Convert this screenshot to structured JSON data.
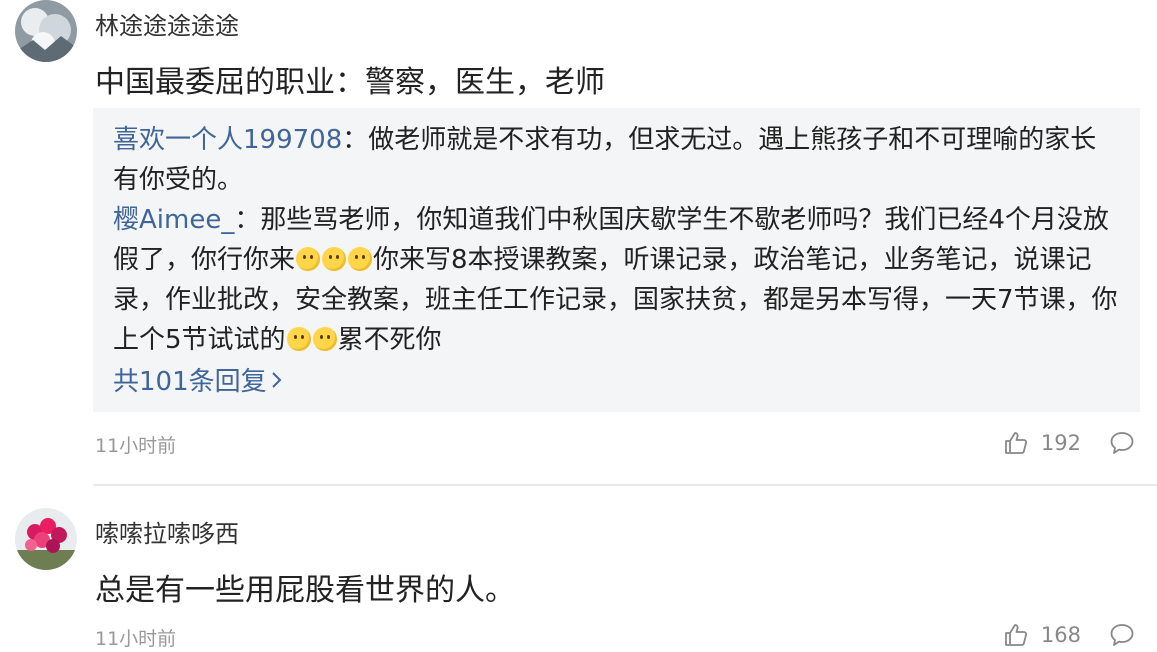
{
  "comments": [
    {
      "username": "林途途途途途",
      "content": "中国最委屈的职业：警察，医生，老师",
      "replies": [
        {
          "user": "喜欢一个人199708",
          "sep": "：",
          "text": "做老师就是不求有功，但求无过。遇上熊孩子和不可理喻的家长有你受的。"
        },
        {
          "user": "樱Aimee_",
          "sep": "：",
          "text_parts": [
            "那些骂老师，你知道我们中秋国庆歇学生不歇老师吗？我们已经4个月没放假了，你行你来",
            "你来写8本授课教案，听课记录，政治笔记，业务笔记，说课记录，作业批改，安全教案，班主任工作记录，国家扶贫，都是另本写得，一天7节课，你上个5节试试的",
            "累不死你"
          ],
          "emoji_groups": [
            3,
            2
          ],
          "emoji_icon": "smile-emoji-icon"
        }
      ],
      "more_replies": "共101条回复",
      "time": "11小时前",
      "likes": "192"
    },
    {
      "username": "嗦嗦拉嗦哆西",
      "content": "总是有一些用屁股看世界的人。",
      "time": "11小时前",
      "likes": "168"
    }
  ],
  "icons": {
    "like": "thumbs-up-icon",
    "reply": "comment-bubble-icon",
    "more": "chevron-right-icon"
  },
  "colors": {
    "link": "#406599",
    "reply_bg": "#f4f5f6",
    "meta": "#999999"
  }
}
